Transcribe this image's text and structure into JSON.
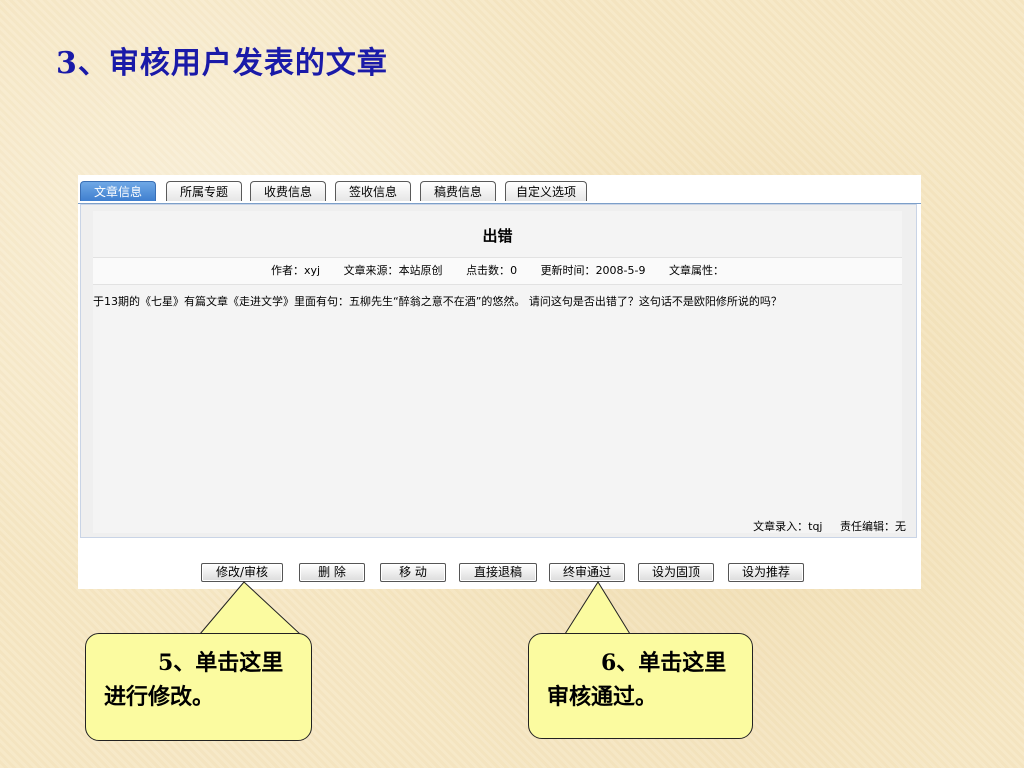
{
  "slide": {
    "title": "3、审核用户发表的文章"
  },
  "tabs": [
    {
      "label": "文章信息",
      "active": true
    },
    {
      "label": "所属专题"
    },
    {
      "label": "收费信息"
    },
    {
      "label": "签收信息"
    },
    {
      "label": "稿费信息"
    },
    {
      "label": "自定义选项"
    }
  ],
  "article": {
    "title": "出错",
    "meta": {
      "author_label": "作者：",
      "author": "xyj",
      "source_label": "文章来源：",
      "source": "本站原创",
      "hits_label": "点击数：",
      "hits": "0",
      "updated_label": "更新时间：",
      "updated": "2008-5-9",
      "attr_label": "文章属性：",
      "attr": ""
    },
    "body": "于13期的《七星》有篇文章《走进文学》里面有句：五柳先生“醉翁之意不在酒”的悠然。   请问这句是否出错了？这句话不是欧阳修所说的吗？",
    "footer": {
      "entered_by_label": "文章录入：",
      "entered_by": "tqj",
      "editor_label": "责任编辑：",
      "editor": "无"
    }
  },
  "buttons": {
    "edit": "修改/审核",
    "delete": "删 除",
    "move": "移 动",
    "reject": "直接退稿",
    "approve": "终审通过",
    "pin": "设为固顶",
    "recommend": "设为推荐"
  },
  "callouts": {
    "left": "5、单击这里进行修改。",
    "right": "6、单击这里审核通过。"
  },
  "colors": {
    "title": "#1a1aa8",
    "active_tab": "#3f7fcf",
    "callout_bg": "#fbfba0"
  }
}
